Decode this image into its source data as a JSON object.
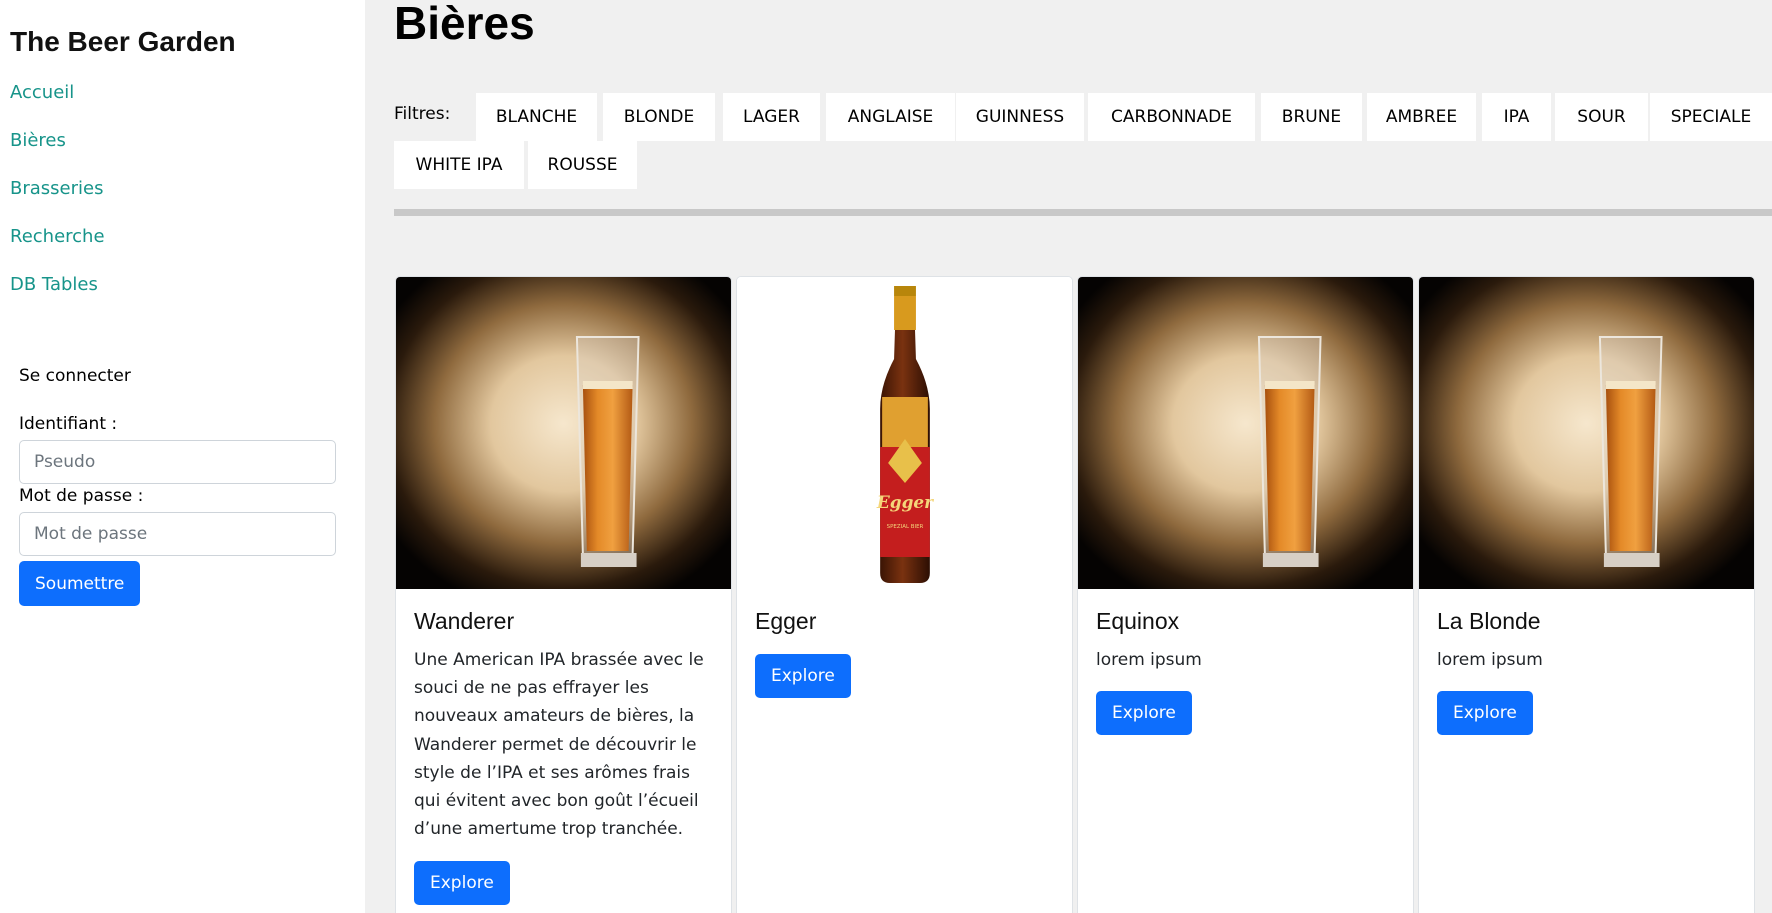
{
  "sidebar": {
    "title": "The Beer Garden",
    "nav": [
      "Accueil",
      "Bières",
      "Brasseries",
      "Recherche",
      "DB Tables"
    ],
    "login": {
      "title": "Se connecter",
      "username_label": "Identifiant :",
      "username_placeholder": "Pseudo",
      "password_label": "Mot de passe :",
      "password_placeholder": "Mot de passe",
      "submit": "Soumettre"
    }
  },
  "main": {
    "title": "Bières",
    "filters_label": "Filtres:",
    "filters": [
      "BLANCHE",
      "BLONDE",
      "LAGER",
      "ANGLAISE",
      "GUINNESS",
      "CARBONNADE",
      "BRUNE",
      "AMBREE",
      "IPA",
      "SOUR",
      "SPECIALE",
      "WHITE IPA",
      "ROUSSE"
    ],
    "cards": [
      {
        "name": "Wanderer",
        "image": "beer-glass-image",
        "description_lines": [
          "Une American IPA brassée avec le",
          "souci de ne pas effrayer les",
          "nouveaux amateurs de bières, la",
          "Wanderer permet de découvrir le",
          "style de l’IPA et ses arômes frais",
          "qui évitent avec bon goût l’écueil",
          "d’une amertume trop tranchée."
        ],
        "button": "Explore"
      },
      {
        "name": "Egger",
        "image": "beer-bottle-image",
        "bottle_label": "Egger",
        "bottle_sublabel": "SPEZIAL BIER",
        "description_lines": [],
        "button": "Explore"
      },
      {
        "name": "Equinox",
        "image": "beer-glass-image",
        "description_lines": [
          "lorem ipsum"
        ],
        "button": "Explore"
      },
      {
        "name": "La Blonde",
        "image": "beer-glass-image",
        "description_lines": [
          "lorem ipsum"
        ],
        "button": "Explore"
      }
    ]
  },
  "colors": {
    "link": "#17948a",
    "primary": "#0d6efd",
    "page_background": "#f0f0f0"
  }
}
